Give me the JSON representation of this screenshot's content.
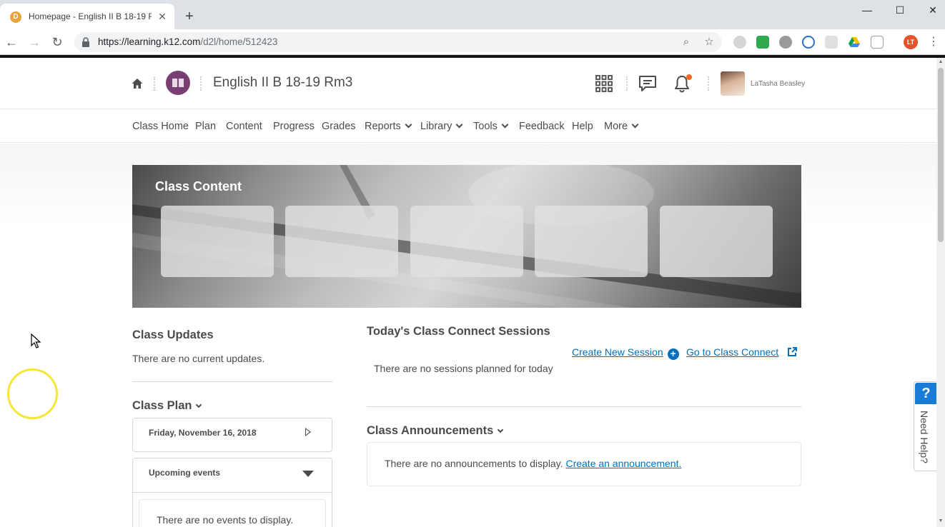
{
  "browser": {
    "tab_title": "Homepage - English II B 18-19 R",
    "url_host": "https://learning.k12.com",
    "url_path": "/d2l/home/512423",
    "profile_initials": "LT"
  },
  "header": {
    "course_title": "English II B 18-19 Rm3",
    "user_name": "LaTasha Beasley"
  },
  "nav": {
    "items": [
      "Class Home",
      "Plan",
      "Content",
      "Progress",
      "Grades",
      "Reports",
      "Library",
      "Tools",
      "Feedback",
      "Help",
      "More"
    ]
  },
  "banner": {
    "title": "Class Content"
  },
  "class_updates": {
    "title": "Class Updates",
    "empty": "There are no current updates."
  },
  "class_plan": {
    "title": "Class Plan",
    "date": "Friday, November 16, 2018",
    "upcoming": "Upcoming events",
    "no_events": "There are no events to display."
  },
  "sessions": {
    "title": "Today's Class Connect Sessions",
    "create_link": "Create New Session",
    "goto_link": "Go to Class Connect",
    "empty": "There are no sessions planned for today"
  },
  "announcements": {
    "title": "Class Announcements",
    "empty": "There are no announcements to display.",
    "create_link": "Create an announcement."
  },
  "help_tab": {
    "symbol": "?",
    "label": "Need Help?"
  },
  "colors": {
    "link": "#006fbf",
    "course_logo": "#7a3f72",
    "notification": "#f26a21",
    "help_blue": "#1a7bd6"
  }
}
